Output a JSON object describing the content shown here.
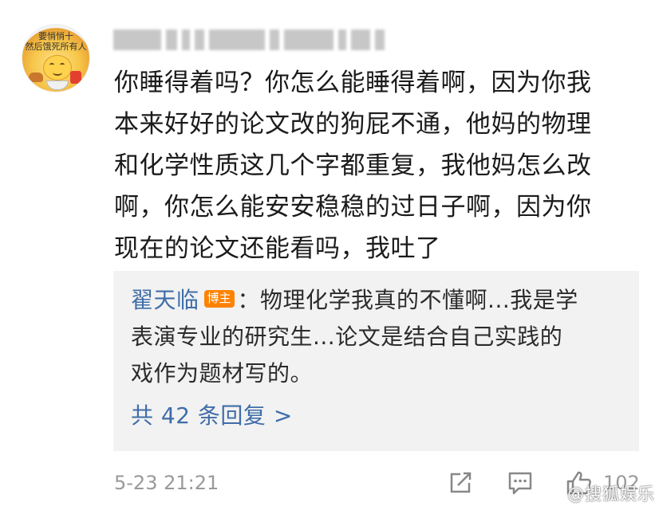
{
  "comment": {
    "lines": [
      "你睡得着吗？你怎么能睡得着啊，因为你我",
      "本来好好的论文改的狗屁不通，他妈的物理",
      "和化学性质这几个字都重复，我他妈怎么改",
      "啊，你怎么能安安稳稳的过日子啊，因为你",
      "现在的论文还能看吗，我吐了"
    ]
  },
  "reply": {
    "author": "翟天临",
    "badge": "博主",
    "separator": "：",
    "text_lines": [
      "物理化学我真的不懂啊...我是学",
      "表演专业的研究生...论文是结合自己实践的",
      "戏作为题材写的。"
    ],
    "more_link": "共 42 条回复 >"
  },
  "footer": {
    "timestamp": "5-23 21:21",
    "like_count": "102"
  },
  "avatar": {
    "text_line1": "要悄悄十",
    "text_line2": "然后饿死所有人"
  },
  "watermark": "@搜狐娱乐",
  "colors": {
    "link_blue": "#3f6da8",
    "badge_orange": "#ff8200",
    "reply_bg": "#f2f2f2",
    "meta_gray": "#999999"
  },
  "icons": [
    "share-icon",
    "reply-icon",
    "like-icon"
  ]
}
